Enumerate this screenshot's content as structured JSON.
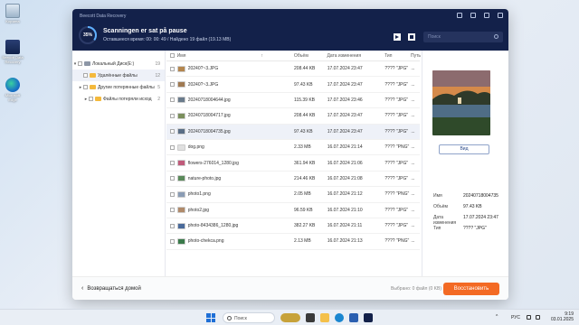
{
  "desktop": {
    "icons": [
      {
        "label": "Корзина"
      },
      {
        "label": "Beecott Data Recovery"
      },
      {
        "label": "Microsoft Edge"
      }
    ]
  },
  "app": {
    "title": "Beecott Data Recovery",
    "progress_percent": 35,
    "progress_label": "35%",
    "scan_status": "Scanningen er sat på pause",
    "scan_details": "Оставшееся время: 00: 00: 49 / Найдено 19 файл (19.13 MB)",
    "search_placeholder": "Поиск",
    "accent": "#f36a24",
    "titlebar_color": "#13214a"
  },
  "tree": {
    "items": [
      {
        "label": "Локальный Диск(E:)",
        "count": "19"
      },
      {
        "label": "Удалённые файлы",
        "count": "12"
      },
      {
        "label": "Другие потерянные файлы",
        "count": "5"
      },
      {
        "label": "Файлы потеряли исход",
        "count": "2"
      }
    ]
  },
  "table": {
    "headers": {
      "name": "Имя",
      "size": "Объём",
      "date": "Дата изменения",
      "type": "Тип",
      "path": "Путь"
    },
    "rows": [
      {
        "name": "20240?~3.JPG",
        "size": "208.44 KB",
        "date": "17.07.2024 23:47",
        "type": "???? \"JPG\"",
        "path": "..."
      },
      {
        "name": "20240?~3.JPG",
        "size": "97.43 KB",
        "date": "17.07.2024 23:47",
        "type": "???? \"JPG\"",
        "path": "..."
      },
      {
        "name": "20240718004644.jpg",
        "size": "115.39 KB",
        "date": "17.07.2024 23:46",
        "type": "???? \"JPG\"",
        "path": "..."
      },
      {
        "name": "20240718004717.jpg",
        "size": "208.44 KB",
        "date": "17.07.2024 23:47",
        "type": "???? \"JPG\"",
        "path": "..."
      },
      {
        "name": "20240718004735.jpg",
        "size": "97.43 KB",
        "date": "17.07.2024 23:47",
        "type": "???? \"JPG\"",
        "path": "..."
      },
      {
        "name": "dog.png",
        "size": "2.33 MB",
        "date": "16.07.2024 21:14",
        "type": "???? \"PNG\"",
        "path": "..."
      },
      {
        "name": "flowers-276014_1280.jpg",
        "size": "361.94 KB",
        "date": "16.07.2024 21:06",
        "type": "???? \"JPG\"",
        "path": "..."
      },
      {
        "name": "nature-photo.jpg",
        "size": "214.46 KB",
        "date": "16.07.2024 21:08",
        "type": "???? \"JPG\"",
        "path": "..."
      },
      {
        "name": "photo1.png",
        "size": "2.05 MB",
        "date": "16.07.2024 21:12",
        "type": "???? \"PNG\"",
        "path": "..."
      },
      {
        "name": "photo2.jpg",
        "size": "96.59 KB",
        "date": "16.07.2024 21:10",
        "type": "???? \"JPG\"",
        "path": "..."
      },
      {
        "name": "photo-8434386_1280.jpg",
        "size": "382.27 KB",
        "date": "16.07.2024 21:11",
        "type": "???? \"JPG\"",
        "path": "..."
      },
      {
        "name": "photo-chekca.png",
        "size": "2.13 MB",
        "date": "16.07.2024 21:13",
        "type": "???? \"PNG\"",
        "path": "..."
      }
    ]
  },
  "preview": {
    "button": "Вид",
    "meta": [
      {
        "key": "Имя",
        "value": "20240718004735"
      },
      {
        "key": "Объём",
        "value": "97.43 KB"
      },
      {
        "key": "Дата изменения",
        "value": "17.07.2024 23:47"
      },
      {
        "key": "Тип",
        "value": "???? \"JPG\""
      }
    ]
  },
  "footer": {
    "back": "Возвращаться домой",
    "selection": "Выбрано: 0 файл (0 KB)",
    "recover": "Восстановить"
  },
  "taskbar": {
    "search": "Поиск",
    "lang": "РУС",
    "time": "9:19",
    "date": "03.01.2025"
  }
}
